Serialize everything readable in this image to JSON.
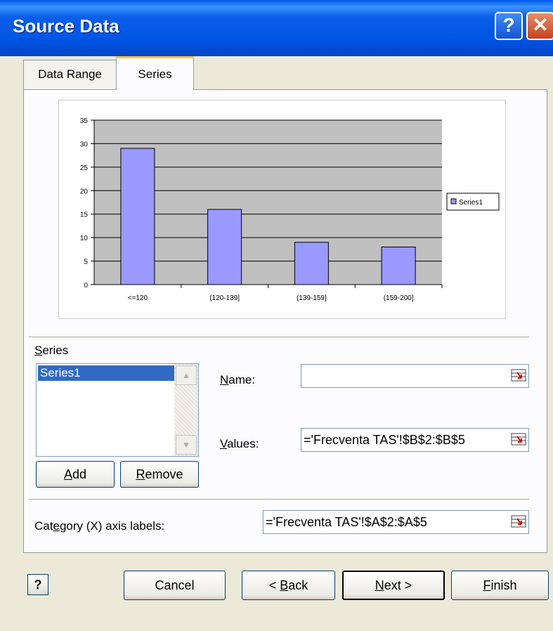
{
  "window": {
    "title": "Source Data",
    "help_label": "?",
    "close_label": "✕"
  },
  "tabs": [
    {
      "label": "Data Range",
      "active": false
    },
    {
      "label": "Series",
      "active": true
    }
  ],
  "chart_data": {
    "type": "bar",
    "categories": [
      "<=120",
      "(120-139]",
      "(139-159]",
      "(159-200]"
    ],
    "series": [
      {
        "name": "Series1",
        "values": [
          29,
          16,
          9,
          8
        ],
        "color": "#9999ff"
      }
    ],
    "ylim": [
      0,
      35
    ],
    "yticks": [
      0,
      5,
      10,
      15,
      20,
      25,
      30,
      35
    ],
    "legend_position": "right",
    "plot_background": "#c0c0c0",
    "grid": true
  },
  "series_section": {
    "label_prefix": "S",
    "label_rest": "eries",
    "items": [
      "Series1"
    ],
    "selected": "Series1",
    "add_prefix": "A",
    "add_rest": "dd",
    "remove_prefix": "R",
    "remove_rest": "emove"
  },
  "fields": {
    "name_prefix": "N",
    "name_rest": "ame:",
    "name_value": "",
    "values_prefix": "V",
    "values_rest": "alues:",
    "values_value": "='Frecventa TAS'!$B$2:$B$5",
    "category_pre": "Cat",
    "category_u": "e",
    "category_post": "gory (X) axis labels:",
    "category_value": "='Frecventa TAS'!$A$2:$A$5"
  },
  "buttons": {
    "help_glyph": "?",
    "cancel": "Cancel",
    "back_pre": "< ",
    "back_u": "B",
    "back_post": "ack",
    "next_u": "N",
    "next_post": "ext >",
    "finish_u": "F",
    "finish_post": "inish"
  },
  "colors": {
    "titlebar": "#0054e3",
    "selection": "#316ac5",
    "bar_fill": "#9999ff",
    "plot_area": "#c0c0c0"
  }
}
